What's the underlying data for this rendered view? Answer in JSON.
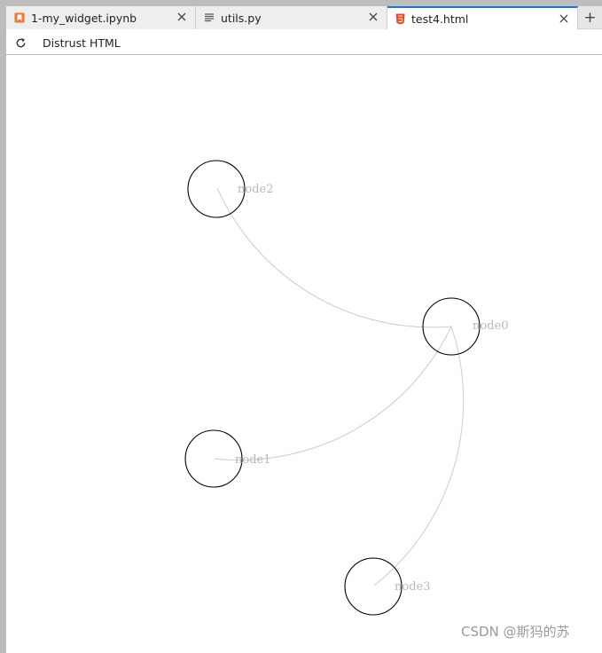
{
  "tabs": [
    {
      "label": "1-my_widget.ipynb",
      "icon": "notebook-icon",
      "active": false
    },
    {
      "label": "utils.py",
      "icon": "text-file-icon",
      "active": false
    },
    {
      "label": "test4.html",
      "icon": "html5-icon",
      "active": true
    }
  ],
  "toolbar": {
    "refresh_icon": "refresh-icon",
    "trust_label": "Distrust HTML"
  },
  "graph": {
    "nodes": [
      {
        "id": "node0",
        "label": "node0"
      },
      {
        "id": "node1",
        "label": "node1"
      },
      {
        "id": "node2",
        "label": "node2"
      },
      {
        "id": "node3",
        "label": "node3"
      }
    ],
    "edges": [
      {
        "source": "node2",
        "target": "node0"
      },
      {
        "source": "node1",
        "target": "node0"
      },
      {
        "source": "node3",
        "target": "node0"
      }
    ]
  },
  "watermark": "CSDN @斯犸的苏",
  "colors": {
    "accent": "#1976d2",
    "notebook_icon": "#f37726",
    "html_icon": "#e34c26",
    "link": "#cccccc",
    "node_stroke": "#000000",
    "node_label": "#b8b8b8"
  }
}
